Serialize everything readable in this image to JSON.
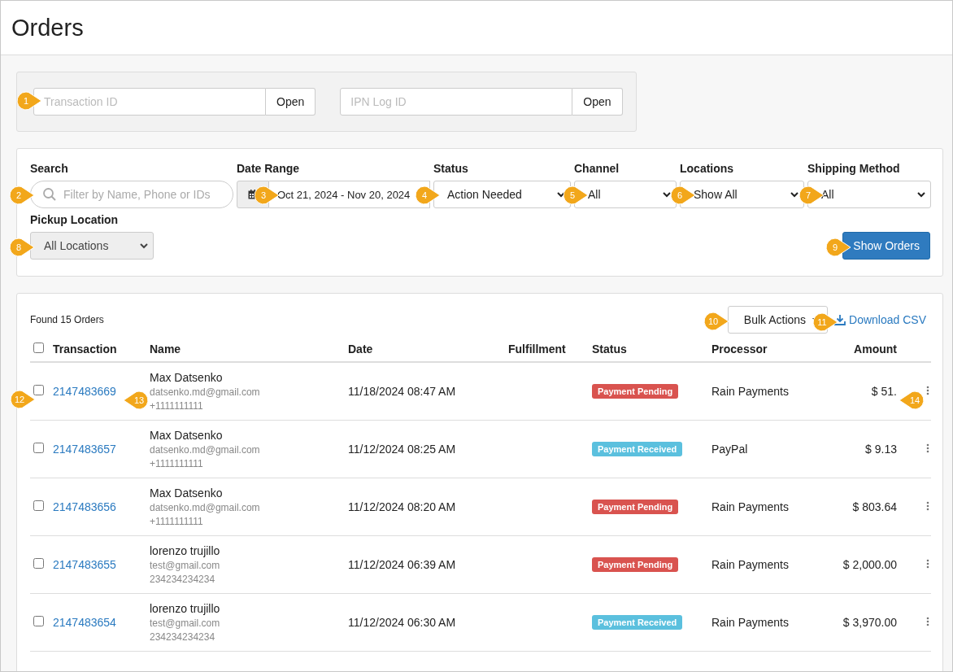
{
  "page": {
    "title": "Orders"
  },
  "lookups": [
    {
      "placeholder": "Transaction ID",
      "button": "Open"
    },
    {
      "placeholder": "IPN Log ID",
      "button": "Open"
    }
  ],
  "filters": {
    "search": {
      "label": "Search",
      "placeholder": "Filter by Name, Phone or IDs"
    },
    "date_range": {
      "label": "Date Range",
      "value": "Oct 21, 2024 - Nov 20, 2024"
    },
    "selects": [
      {
        "label": "Status",
        "value": "Action Needed"
      },
      {
        "label": "Channel",
        "value": "All"
      },
      {
        "label": "Locations",
        "value": "Show All"
      },
      {
        "label": "Shipping Method",
        "value": "All"
      }
    ],
    "pickup": {
      "label": "Pickup Location",
      "value": "All Locations"
    },
    "show_button": "Show Orders"
  },
  "orders": {
    "found": "Found 15 Orders",
    "bulk_actions": "Bulk Actions",
    "download": "Download CSV",
    "columns": [
      "Transaction",
      "Name",
      "Date",
      "Fulfillment",
      "Status",
      "Processor",
      "Amount"
    ],
    "select_all_checked": false,
    "rows": [
      {
        "checked": false,
        "id": "2147483669",
        "name": "Max Datsenko",
        "email": "datsenko.md@gmail.com",
        "phone": "+1111111111",
        "date": "11/18/2024 08:47 AM",
        "status": {
          "kind": "pending",
          "label": "Payment Pending"
        },
        "processor": "Rain Payments",
        "amount": "$ 51."
      },
      {
        "checked": false,
        "id": "2147483657",
        "name": "Max Datsenko",
        "email": "datsenko.md@gmail.com",
        "phone": "+1111111111",
        "date": "11/12/2024 08:25 AM",
        "status": {
          "kind": "received",
          "label": "Payment Received"
        },
        "processor": "PayPal",
        "amount": "$ 9.13"
      },
      {
        "checked": false,
        "id": "2147483656",
        "name": "Max Datsenko",
        "email": "datsenko.md@gmail.com",
        "phone": "+1111111111",
        "date": "11/12/2024 08:20 AM",
        "status": {
          "kind": "pending",
          "label": "Payment Pending"
        },
        "processor": "Rain Payments",
        "amount": "$ 803.64"
      },
      {
        "checked": false,
        "id": "2147483655",
        "name": "lorenzo trujillo",
        "email": "test@gmail.com",
        "phone": "234234234234",
        "date": "11/12/2024 06:39 AM",
        "status": {
          "kind": "pending",
          "label": "Payment Pending"
        },
        "processor": "Rain Payments",
        "amount": "$ 2,000.00"
      },
      {
        "checked": false,
        "id": "2147483654",
        "name": "lorenzo trujillo",
        "email": "test@gmail.com",
        "phone": "234234234234",
        "date": "11/12/2024 06:30 AM",
        "status": {
          "kind": "received",
          "label": "Payment Received"
        },
        "processor": "Rain Payments",
        "amount": "$ 3,970.00"
      }
    ]
  },
  "callouts": [
    {
      "number": "1",
      "kind": "right"
    },
    {
      "number": "2",
      "kind": "right"
    },
    {
      "number": "3",
      "kind": "right"
    },
    {
      "number": "4",
      "kind": "right"
    },
    {
      "number": "5",
      "kind": "right"
    },
    {
      "number": "6",
      "kind": "right"
    },
    {
      "number": "7",
      "kind": "right"
    },
    {
      "number": "8",
      "kind": "right"
    },
    {
      "number": "9",
      "kind": "right"
    },
    {
      "number": "10",
      "kind": "right"
    },
    {
      "number": "11",
      "kind": "right"
    },
    {
      "number": "12",
      "kind": "right"
    },
    {
      "number": "13",
      "kind": "left"
    },
    {
      "number": "14",
      "kind": "left"
    }
  ]
}
